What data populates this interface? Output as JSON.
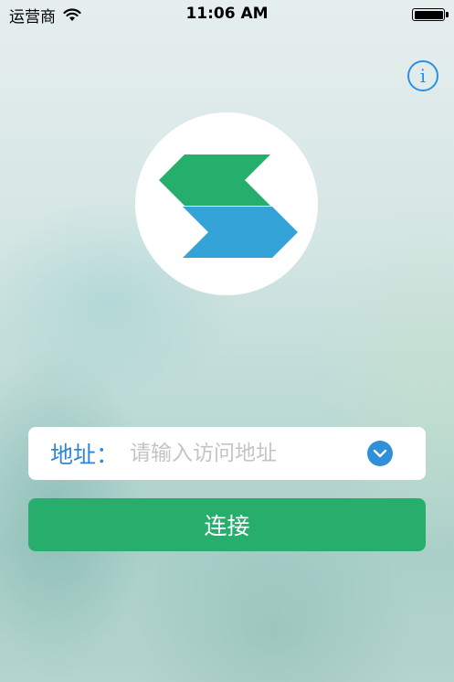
{
  "status_bar": {
    "carrier": "运营商",
    "time": "11:06 AM"
  },
  "address": {
    "label": "地址：",
    "placeholder": "请输入访问地址",
    "value": ""
  },
  "connect": {
    "label": "连接"
  },
  "colors": {
    "primary_green": "#27ad6c",
    "logo_green": "#26ae6c",
    "logo_blue": "#34a4d8",
    "accent_blue": "#2f8fe0"
  },
  "icons": {
    "info": "info-icon",
    "dropdown": "chevron-down-icon",
    "logo": "app-logo-icon"
  }
}
